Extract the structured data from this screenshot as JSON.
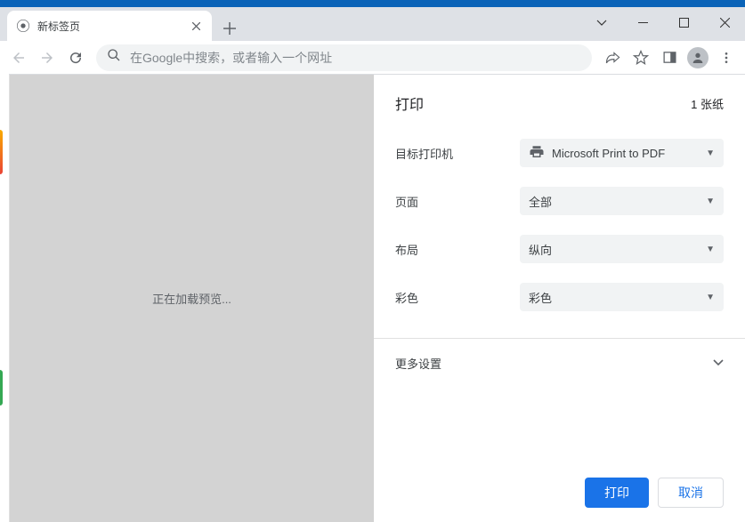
{
  "window": {
    "tab_title": "新标签页"
  },
  "toolbar": {
    "omnibox_placeholder": "在Google中搜索，或者输入一个网址"
  },
  "print": {
    "title": "打印",
    "sheet_count": "1 张纸",
    "destination_label": "目标打印机",
    "destination_value": "Microsoft Print to PDF",
    "pages_label": "页面",
    "pages_value": "全部",
    "layout_label": "布局",
    "layout_value": "纵向",
    "color_label": "彩色",
    "color_value": "彩色",
    "more_settings": "更多设置",
    "preview_loading": "正在加载预览...",
    "print_button": "打印",
    "cancel_button": "取消"
  }
}
